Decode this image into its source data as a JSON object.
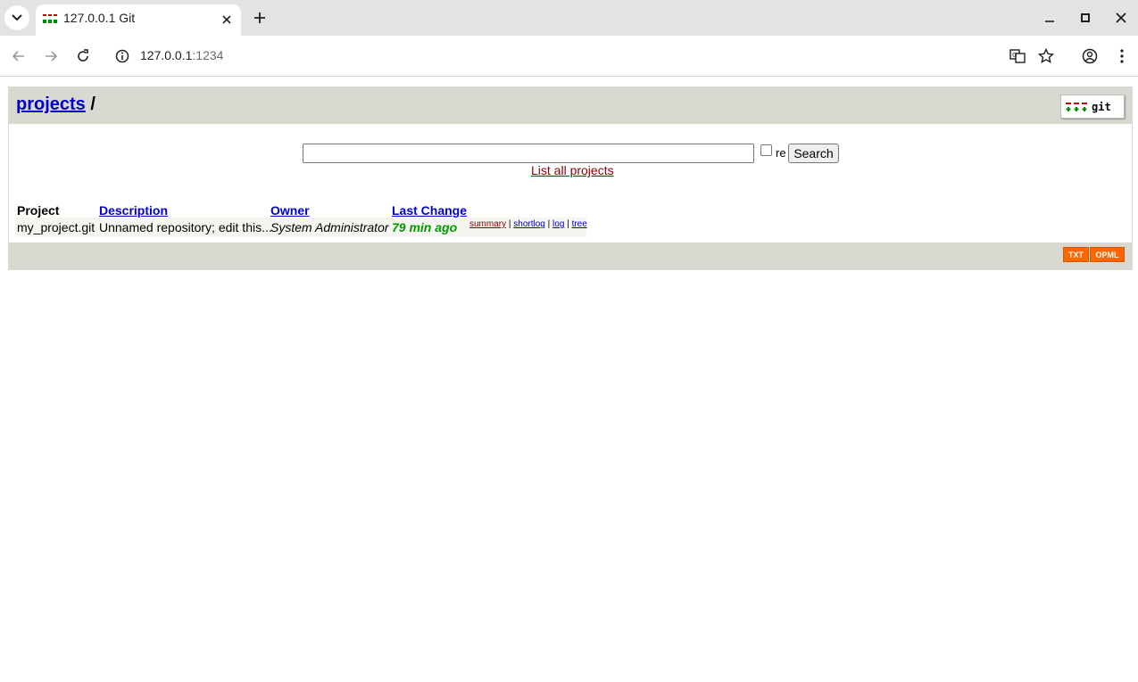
{
  "browser": {
    "tab_title": "127.0.0.1 Git",
    "url_host": "127.0.0.1",
    "url_port": ":1234"
  },
  "header": {
    "projects_link": "projects",
    "separator": " /",
    "logo_text": "git"
  },
  "search": {
    "input_value": "",
    "regex_label": "re",
    "button_label": "Search",
    "list_all_link": "List all projects"
  },
  "table": {
    "columns": [
      "Project",
      "Description",
      "Owner",
      "Last Change"
    ],
    "rows": [
      {
        "project": "my_project.git",
        "description": "Unnamed repository; edit this...",
        "owner": "System Administrator",
        "last_change": "79 min ago",
        "links": [
          "summary",
          "shortlog",
          "log",
          "tree"
        ]
      }
    ]
  },
  "footer": {
    "txt_badge": "TXT",
    "opml_badge": "OPML"
  },
  "colors": {
    "chrome_bg": "#e3e3e3",
    "header_bg": "#d9d8d1",
    "link_blue": "#0000cc",
    "link_dark_red": "#880000",
    "age_green": "#009900",
    "feed_orange": "#ff6600"
  },
  "icons": [
    "tab-list-icon",
    "git-favicon-icon",
    "close-icon",
    "plus-icon",
    "minimize-icon",
    "maximize-icon",
    "back-arrow-icon",
    "forward-arrow-icon",
    "reload-icon",
    "site-info-icon",
    "translate-icon",
    "star-icon",
    "profile-icon",
    "kebab-menu-icon"
  ]
}
